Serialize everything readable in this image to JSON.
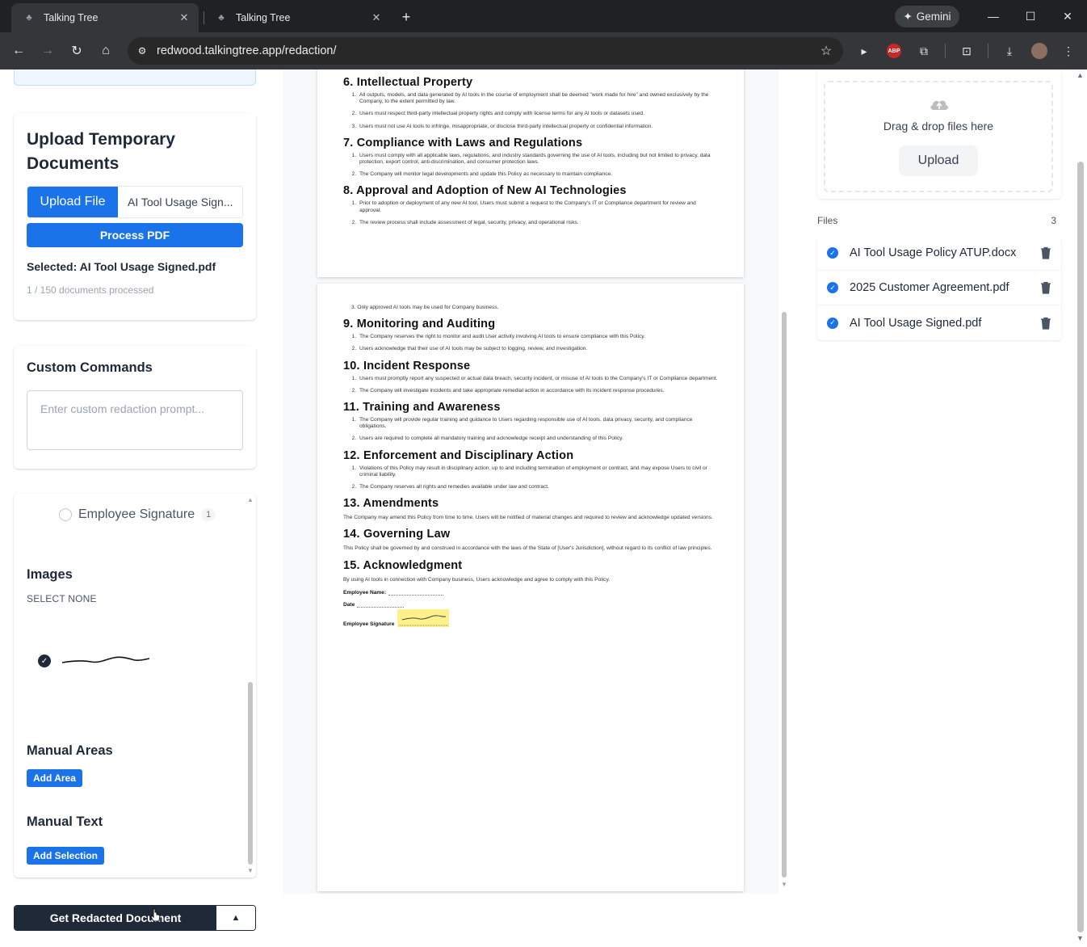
{
  "browser": {
    "tabs": [
      {
        "title": "Talking Tree",
        "active": true
      },
      {
        "title": "Talking Tree",
        "active": false
      }
    ],
    "url": "redwood.talkingtree.app/redaction/",
    "gemini_label": "Gemini",
    "abp_label": "ABP"
  },
  "upload_card": {
    "title": "Upload Temporary Documents",
    "upload_file_label": "Upload File",
    "file_name_display": "AI Tool Usage Sign...",
    "process_label": "Process PDF",
    "selected_text": "Selected: AI Tool Usage Signed.pdf",
    "processed_text": "1 / 150 documents processed"
  },
  "custom_commands": {
    "title": "Custom Commands",
    "placeholder": "Enter custom redaction prompt..."
  },
  "redaction_panel": {
    "signature_label": "Employee Signature",
    "signature_count": "1",
    "images_title": "Images",
    "select_none": "SELECT NONE",
    "manual_areas_title": "Manual Areas",
    "add_area_label": "Add Area",
    "manual_text_title": "Manual Text",
    "add_selection_label": "Add Selection"
  },
  "get_document_label": "Get Redacted Document",
  "document": {
    "page1": [
      {
        "heading": "6. Intellectual Property",
        "items": [
          "All outputs, models, and data generated by AI tools in the course of employment shall be deemed \"work made for hire\" and owned exclusively by the Company, to the extent permitted by law.",
          "Users must respect third-party intellectual property rights and comply with license terms for any AI tools or datasets used.",
          "Users must not use AI tools to infringe, misappropriate, or disclose third-party intellectual property or confidential information."
        ]
      },
      {
        "heading": "7. Compliance with Laws and Regulations",
        "items": [
          "Users must comply with all applicable laws, regulations, and industry standards governing the use of AI tools, including but not limited to privacy, data protection, export control, anti-discrimination, and consumer protection laws.",
          "The Company will monitor legal developments and update this Policy as necessary to maintain compliance."
        ]
      },
      {
        "heading": "8. Approval and Adoption of New AI Technologies",
        "items": [
          "Prior to adoption or deployment of any new AI tool, Users must submit a request to the Company's IT or Compliance department for review and approval.",
          "The review process shall include assessment of legal, security, privacy, and operational risks."
        ]
      }
    ],
    "page2_lead": "3. Only approved AI tools may be used for Company business.",
    "page2": [
      {
        "heading": "9. Monitoring and Auditing",
        "items": [
          "The Company reserves the right to monitor and audit User activity involving AI tools to ensure compliance with this Policy.",
          "Users acknowledge that their use of AI tools may be subject to logging, review, and investigation."
        ]
      },
      {
        "heading": "10. Incident Response",
        "items": [
          "Users must promptly report any suspected or actual data breach, security incident, or misuse of AI tools to the Company's IT or Compliance department.",
          "The Company will investigate incidents and take appropriate remedial action in accordance with its incident response procedures."
        ]
      },
      {
        "heading": "11. Training and Awareness",
        "items": [
          "The Company will provide regular training and guidance to Users regarding responsible use of AI tools, data privacy, security, and compliance obligations.",
          "Users are required to complete all mandatory training and acknowledge receipt and understanding of this Policy."
        ]
      },
      {
        "heading": "12. Enforcement and Disciplinary Action",
        "items": [
          "Violations of this Policy may result in disciplinary action, up to and including termination of employment or contract, and may expose Users to civil or criminal liability.",
          "The Company reserves all rights and remedies available under law and contract."
        ]
      }
    ],
    "amendments_heading": "13. Amendments",
    "amendments_text": "The Company may amend this Policy from time to time. Users will be notified of material changes and required to review and acknowledge updated versions.",
    "governing_heading": "14. Governing Law",
    "governing_text": "This Policy shall be governed by and construed in accordance with the laws of the State of [User's Jurisdiction], without regard to its conflict of law principles.",
    "ack_heading": "15. Acknowledgment",
    "ack_text": "By using AI tools in connection with Company business, Users acknowledge and agree to comply with this Policy.",
    "field_name": "Employee Name:",
    "field_date": "Date",
    "field_signature": "Employee Signature"
  },
  "right_panel": {
    "drop_text": "Drag & drop files here",
    "upload_label": "Upload",
    "files_label": "Files",
    "files_count": "3",
    "files": [
      "AI Tool Usage Policy ATUP.docx",
      "2025 Customer Agreement.pdf",
      "AI Tool Usage Signed.pdf"
    ]
  },
  "colors": {
    "primary": "#1a73e8",
    "dark_button": "#1f2937",
    "highlight": "#fef08a"
  }
}
